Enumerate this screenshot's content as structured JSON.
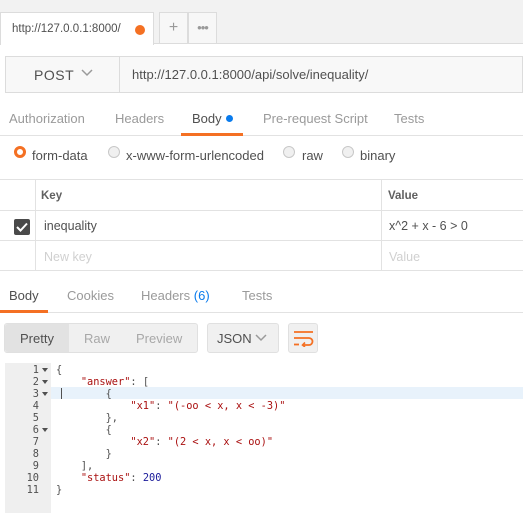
{
  "tab": {
    "title": "http://127.0.0.1:8000/",
    "plus": "+",
    "more": "•••"
  },
  "request": {
    "method": "POST",
    "url": "http://127.0.0.1:8000/api/solve/inequality/",
    "tabs": [
      "Authorization",
      "Headers",
      "Body",
      "Pre-request Script",
      "Tests"
    ],
    "active_tab": "Body"
  },
  "body_types": {
    "options": [
      "form-data",
      "x-www-form-urlencoded",
      "raw",
      "binary"
    ],
    "selected": "form-data"
  },
  "params": {
    "key_header": "Key",
    "value_header": "Value",
    "rows": [
      {
        "key": "inequality",
        "value": "x^2 + x - 6 > 0",
        "enabled": true
      }
    ],
    "new_key_placeholder": "New key",
    "new_value_placeholder": "Value"
  },
  "response": {
    "tabs": {
      "body": "Body",
      "cookies": "Cookies",
      "headers": "Headers",
      "headers_count": "(6)",
      "tests": "Tests"
    },
    "views": [
      "Pretty",
      "Raw",
      "Preview"
    ],
    "format": "JSON",
    "line_numbers": [
      "1",
      "2",
      "3",
      "4",
      "5",
      "6",
      "7",
      "8",
      "9",
      "10",
      "11"
    ],
    "code": {
      "l1": "{",
      "l2_key": "\"answer\"",
      "l2_rest": ": [",
      "l3": "{",
      "l4_key": "\"x1\"",
      "l4_sep": ": ",
      "l4_val": "\"(-oo < x, x < -3)\"",
      "l5": "},",
      "l6": "{",
      "l7_key": "\"x2\"",
      "l7_sep": ": ",
      "l7_val": "\"(2 < x, x < oo)\"",
      "l8": "}",
      "l9": "],",
      "l10_key": "\"status\"",
      "l10_sep": ": ",
      "l10_val": "200",
      "l11": "}"
    }
  },
  "colors": {
    "accent": "#f47023",
    "link": "#097bed"
  }
}
